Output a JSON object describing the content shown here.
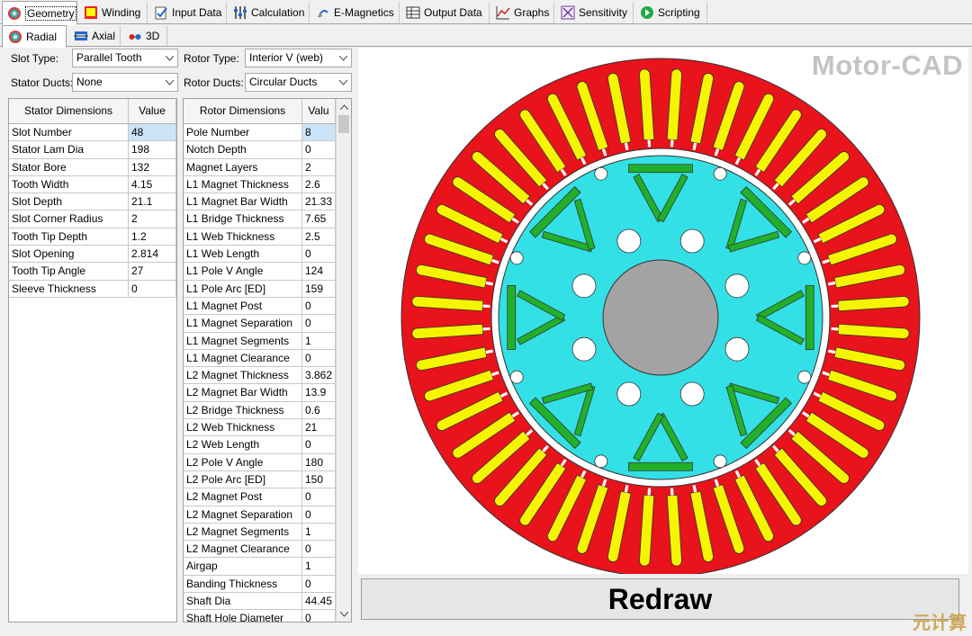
{
  "main_tabs": [
    {
      "label": "Geometry",
      "icon": "geometry-icon",
      "active": true
    },
    {
      "label": "Winding",
      "icon": "winding-icon"
    },
    {
      "label": "Input Data",
      "icon": "input-data-icon"
    },
    {
      "label": "Calculation",
      "icon": "calculation-icon"
    },
    {
      "label": "E-Magnetics",
      "icon": "e-magnetics-icon"
    },
    {
      "label": "Output Data",
      "icon": "output-data-icon"
    },
    {
      "label": "Graphs",
      "icon": "graphs-icon"
    },
    {
      "label": "Sensitivity",
      "icon": "sensitivity-icon"
    },
    {
      "label": "Scripting",
      "icon": "scripting-icon"
    }
  ],
  "sub_tabs": [
    {
      "label": "Radial",
      "icon": "radial-icon",
      "active": true
    },
    {
      "label": "Axial",
      "icon": "axial-icon"
    },
    {
      "label": "3D",
      "icon": "3d-glasses-icon"
    }
  ],
  "controls": {
    "slot_type_label": "Slot Type:",
    "slot_type_value": "Parallel Tooth",
    "stator_ducts_label": "Stator Ducts:",
    "stator_ducts_value": "None",
    "rotor_type_label": "Rotor Type:",
    "rotor_type_value": "Interior V (web)",
    "rotor_ducts_label": "Rotor Ducts:",
    "rotor_ducts_value": "Circular Ducts"
  },
  "stator_grid": {
    "headers": [
      "Stator Dimensions",
      "Value"
    ],
    "rows": [
      [
        "Slot Number",
        "48"
      ],
      [
        "Stator Lam Dia",
        "198"
      ],
      [
        "Stator Bore",
        "132"
      ],
      [
        "Tooth Width",
        "4.15"
      ],
      [
        "Slot Depth",
        "21.1"
      ],
      [
        "Slot Corner Radius",
        "2"
      ],
      [
        "Tooth Tip Depth",
        "1.2"
      ],
      [
        "Slot Opening",
        "2.814"
      ],
      [
        "Tooth Tip Angle",
        "27"
      ],
      [
        "Sleeve Thickness",
        "0"
      ]
    ]
  },
  "rotor_grid": {
    "headers": [
      "Rotor Dimensions",
      "Valu"
    ],
    "rows": [
      [
        "Pole Number",
        "8"
      ],
      [
        "Notch Depth",
        "0"
      ],
      [
        "Magnet Layers",
        "2"
      ],
      [
        "L1 Magnet Thickness",
        "2.6"
      ],
      [
        "L1 Magnet Bar Width",
        "21.33"
      ],
      [
        "L1 Bridge Thickness",
        "7.65"
      ],
      [
        "L1 Web Thickness",
        "2.5"
      ],
      [
        "L1 Web Length",
        "0"
      ],
      [
        "L1 Pole V Angle",
        "124"
      ],
      [
        "L1 Pole Arc [ED]",
        "159"
      ],
      [
        "L1 Magnet Post",
        "0"
      ],
      [
        "L1 Magnet Separation",
        "0"
      ],
      [
        "L1 Magnet Segments",
        "1"
      ],
      [
        "L1 Magnet Clearance",
        "0"
      ],
      [
        "L2 Magnet Thickness",
        "3.862"
      ],
      [
        "L2 Magnet Bar Width",
        "13.9"
      ],
      [
        "L2 Bridge Thickness",
        "0.6"
      ],
      [
        "L2 Web Thickness",
        "21"
      ],
      [
        "L2 Web Length",
        "0"
      ],
      [
        "L2 Pole V Angle",
        "180"
      ],
      [
        "L2 Pole Arc [ED]",
        "150"
      ],
      [
        "L2 Magnet Post",
        "0"
      ],
      [
        "L2 Magnet Separation",
        "0"
      ],
      [
        "L2 Magnet Segments",
        "1"
      ],
      [
        "L2 Magnet Clearance",
        "0"
      ],
      [
        "Airgap",
        "1"
      ],
      [
        "Banding Thickness",
        "0"
      ],
      [
        "Shaft Dia",
        "44.45"
      ],
      [
        "Shaft Hole Diameter",
        "0"
      ]
    ]
  },
  "canvas": {
    "watermark": "Motor-CAD",
    "stator_color": "#e8131b",
    "slot_color": "#f5f500",
    "rotor_color": "#33e0e6",
    "magnet_color": "#22b02a",
    "shaft_color": "#a3a3a3"
  },
  "redraw_label": "Redraw",
  "corner_mark": "元计算"
}
